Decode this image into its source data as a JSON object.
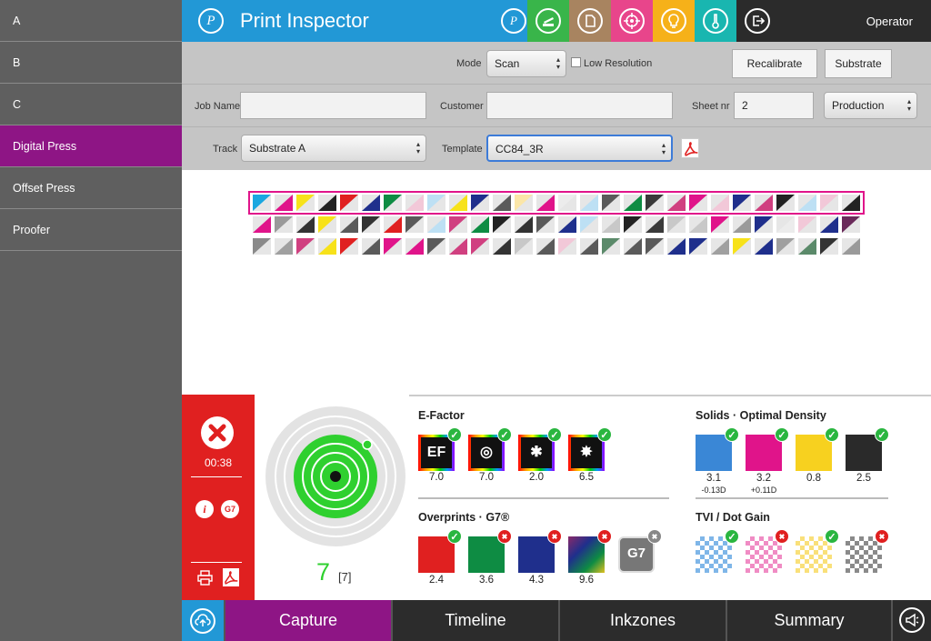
{
  "sidebar": {
    "items": [
      {
        "label": "A",
        "active": false
      },
      {
        "label": "B",
        "active": false
      },
      {
        "label": "C",
        "active": false
      },
      {
        "label": "Digital Press",
        "active": true
      },
      {
        "label": "Offset Press",
        "active": false
      },
      {
        "label": "Proofer",
        "active": false
      }
    ]
  },
  "header": {
    "app_title": "Print Inspector",
    "logo_letter": "P",
    "user": "Operator",
    "tool_buttons": [
      {
        "icon": "p-logo-icon",
        "color": "#2298d6"
      },
      {
        "icon": "scanner-icon",
        "color": "#39b54a"
      },
      {
        "icon": "document-icon",
        "color": "#a88460"
      },
      {
        "icon": "target-icon",
        "color": "#e8458b"
      },
      {
        "icon": "lightbulb-icon",
        "color": "#f6b119"
      },
      {
        "icon": "thermometer-icon",
        "color": "#19b6b0"
      },
      {
        "icon": "logout-icon",
        "color": "#2b2b2b"
      }
    ]
  },
  "toolbar": {
    "mode_label": "Mode",
    "mode_value": "Scan",
    "low_res_label": "Low Resolution",
    "recalibrate_label": "Recalibrate",
    "substrate_label": "Substrate",
    "job_name_label": "Job Name",
    "job_name_value": "",
    "customer_label": "Customer",
    "customer_value": "",
    "sheet_label": "Sheet nr",
    "sheet_value": "2",
    "production_value": "Production",
    "track_label": "Track",
    "track_value": "Substrate A",
    "template_label": "Template",
    "template_value": "CC84_3R"
  },
  "status": {
    "time": "00:38",
    "g7_label": "G7",
    "score": "7",
    "score_total": "[7]"
  },
  "efactor": {
    "title": "E-Factor",
    "items": [
      {
        "icon": "ef-icon",
        "value": "7.0",
        "status": "ok"
      },
      {
        "icon": "target-icon",
        "value": "7.0",
        "status": "ok"
      },
      {
        "icon": "network-icon",
        "value": "2.0",
        "status": "ok"
      },
      {
        "icon": "nodes-icon",
        "value": "6.5",
        "status": "ok"
      }
    ]
  },
  "solids": {
    "title": "Solids · Optimal Density",
    "items": [
      {
        "color": "#3a87d6",
        "value": "3.1",
        "sub": "-0.13D",
        "status": "ok"
      },
      {
        "color": "#e0148a",
        "value": "3.2",
        "sub": "+0.11D",
        "status": "ok"
      },
      {
        "color": "#f7d11f",
        "value": "0.8",
        "sub": "",
        "status": "ok"
      },
      {
        "color": "#2a2a2a",
        "value": "2.5",
        "sub": "",
        "status": "ok"
      }
    ]
  },
  "overprints": {
    "title": "Overprints · G7®",
    "items": [
      {
        "color": "#e02020",
        "value": "2.4",
        "status": "ok"
      },
      {
        "color": "#0e8c43",
        "value": "3.6",
        "status": "bad"
      },
      {
        "color": "#1f2f8c",
        "value": "4.3",
        "status": "bad"
      },
      {
        "color": "#3a2a5a",
        "value": "9.6",
        "status": "bad"
      },
      {
        "color": "#777777",
        "value": "",
        "label": "G7",
        "status": "neutral"
      }
    ]
  },
  "tvi": {
    "title": "TVI / Dot Gain",
    "items": [
      {
        "color": "#7fb6e8",
        "status": "ok"
      },
      {
        "color": "#f08cc4",
        "status": "bad"
      },
      {
        "color": "#f9e07a",
        "status": "ok"
      },
      {
        "color": "#8a8a8a",
        "status": "bad"
      }
    ]
  },
  "bottom_tabs": [
    {
      "label": "Capture",
      "active": true
    },
    {
      "label": "Timeline",
      "active": false
    },
    {
      "label": "Inkzones",
      "active": false
    },
    {
      "label": "Summary",
      "active": false
    }
  ]
}
